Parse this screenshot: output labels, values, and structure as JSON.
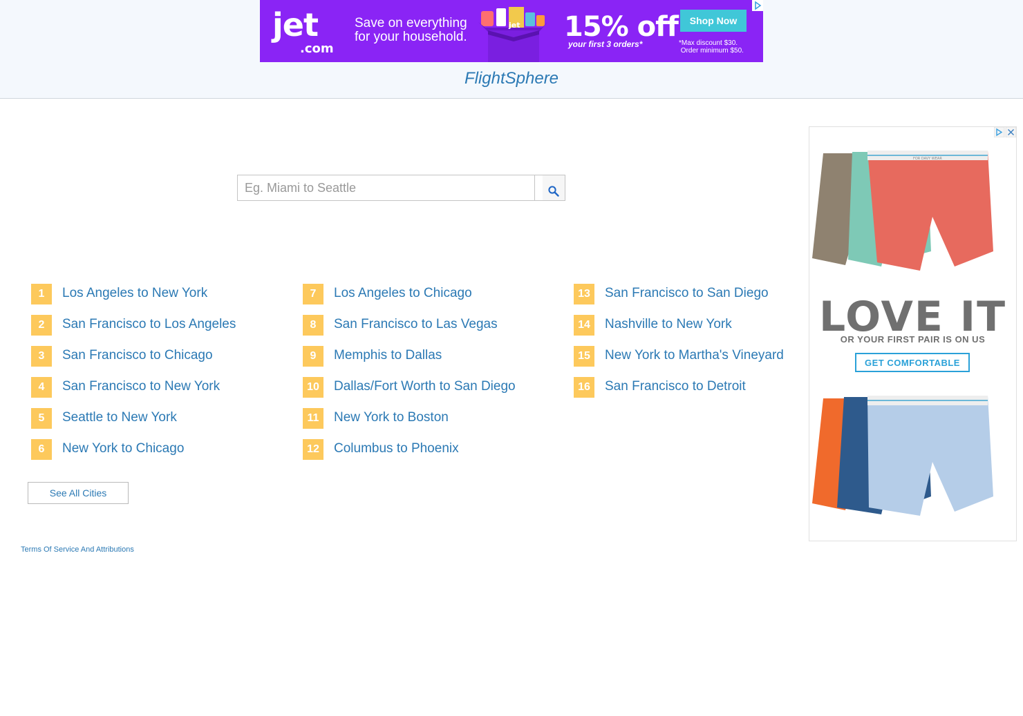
{
  "header": {
    "brand": "FlightSphere"
  },
  "top_ad": {
    "logo": "jet",
    "logo_domain": ".com",
    "tagline": "Save on everything for your household.",
    "box_label": "jet",
    "discount": "15% off",
    "discount_sub": "your first 3 orders*",
    "cta": "Shop Now",
    "fine_print": "*Max discount $30.\n Order minimum $50.",
    "accent_color": "#8a24f5",
    "cta_color": "#40c7d8"
  },
  "search": {
    "placeholder": "Eg. Miami to Seattle",
    "button_icon": "search-icon"
  },
  "routes": {
    "columns": [
      [
        {
          "num": "1",
          "label": "Los Angeles to New York"
        },
        {
          "num": "2",
          "label": "San Francisco to Los Angeles"
        },
        {
          "num": "3",
          "label": "San Francisco to Chicago"
        },
        {
          "num": "4",
          "label": "San Francisco to New York"
        },
        {
          "num": "5",
          "label": "Seattle to New York"
        },
        {
          "num": "6",
          "label": "New York to Chicago"
        }
      ],
      [
        {
          "num": "7",
          "label": "Los Angeles to Chicago"
        },
        {
          "num": "8",
          "label": "San Francisco to Las Vegas"
        },
        {
          "num": "9",
          "label": "Memphis to Dallas"
        },
        {
          "num": "10",
          "label": "Dallas/Fort Worth to San Diego"
        },
        {
          "num": "11",
          "label": "New York to Boston"
        },
        {
          "num": "12",
          "label": "Columbus to Phoenix"
        }
      ],
      [
        {
          "num": "13",
          "label": "San Francisco to San Diego"
        },
        {
          "num": "14",
          "label": "Nashville to New York"
        },
        {
          "num": "15",
          "label": "New York to Martha's Vineyard"
        },
        {
          "num": "16",
          "label": "San Francisco to Detroit"
        }
      ]
    ],
    "badge_color": "#fdc95c",
    "link_color": "#2b79b4"
  },
  "see_all": "See All Cities",
  "footer": {
    "tos": "Terms Of Service And Attributions"
  },
  "side_ad": {
    "headline": "LOVE IT",
    "subline": "OR YOUR FIRST PAIR IS ON US",
    "cta": "GET COMFORTABLE",
    "waistband_text": "FOR DAVY WEAR"
  }
}
